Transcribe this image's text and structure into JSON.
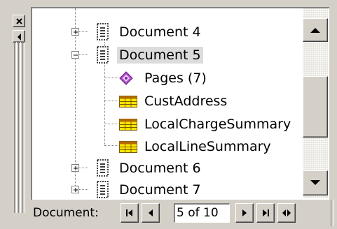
{
  "window": {
    "close_icon": "close-icon",
    "pin_icon": "collapse-left-icon"
  },
  "tree": {
    "items": [
      {
        "label": "Document 4",
        "kind": "document",
        "expanded": false
      },
      {
        "label": "Document 5",
        "kind": "document",
        "expanded": true,
        "selected": true
      },
      {
        "label": "Pages (7)",
        "kind": "pages"
      },
      {
        "label": "CustAddress",
        "kind": "table"
      },
      {
        "label": "LocalChargeSummary",
        "kind": "table"
      },
      {
        "label": "LocalLineSummary",
        "kind": "table"
      },
      {
        "label": "Document 6",
        "kind": "document",
        "expanded": false
      },
      {
        "label": "Document 7",
        "kind": "document",
        "expanded": false
      }
    ]
  },
  "scrollbar": {
    "up_icon": "scroll-up-icon",
    "down_icon": "scroll-down-icon"
  },
  "navigator": {
    "label": "Document:",
    "position_text": "5 of 10",
    "current": 5,
    "total": 10,
    "buttons": [
      "first-icon",
      "previous-icon",
      "next-icon",
      "last-icon",
      "expand-horizontal-icon"
    ]
  },
  "colors": {
    "face": "#d4d0c8",
    "selection": "#dcdcdc",
    "table_icon": "#ffe600",
    "pages_icon": "#b84fd6"
  }
}
